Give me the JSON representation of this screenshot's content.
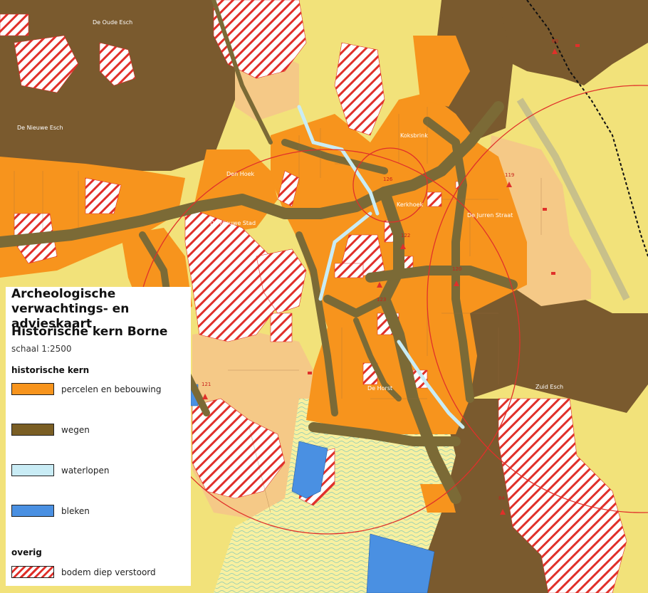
{
  "legend": {
    "title": "Archeologische verwachtings- en advieskaart",
    "subtitle": "Historische kern Borne",
    "scale": "schaal 1:2500",
    "section1": "historische kern",
    "section2": "overig",
    "items": [
      {
        "label": "percelen en bebouwing",
        "color": "#f7941d"
      },
      {
        "label": "wegen",
        "color": "#7a5e24"
      },
      {
        "label": "waterlopen",
        "color": "#c9ecf5"
      },
      {
        "label": "bleken",
        "color": "#4a90e2"
      },
      {
        "label": "bodem diep verstoord",
        "color": "#e0302a"
      }
    ]
  },
  "place_labels": [
    "De Oude Esch",
    "De Nieuwe Esch",
    "Den Hoek",
    "De Nieuwe Stad",
    "Koksbrink",
    "Kerkhoek",
    "De Jurren Straat",
    "De Horst",
    "Zuid Esch"
  ],
  "site_numbers": [
    "60",
    "126",
    "119",
    "122",
    "120",
    "123",
    "121",
    "84"
  ],
  "colors": {
    "brown": "#7a5a2e",
    "orange": "#f7941d",
    "light_orange": "#f5c987",
    "yellow": "#f2e27a",
    "pale_yellow": "#f8f0a0",
    "road": "#7b6a36",
    "water": "#c9ecf5",
    "blue": "#4a90e2",
    "red": "#e0302a"
  }
}
